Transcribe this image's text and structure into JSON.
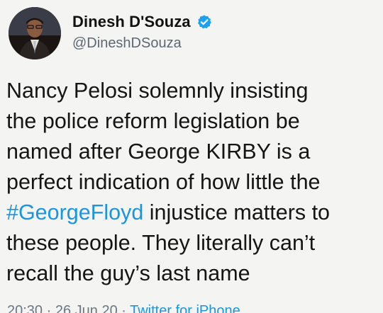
{
  "author": {
    "name": "Dinesh D'Souza",
    "handle": "@DineshDSouza",
    "verified_icon": "verified-badge",
    "verified_color": "#1da1f2"
  },
  "tweet": {
    "line1": "Nancy Pelosi solemnly insisting",
    "line2": "the police reform legislation be",
    "line3": "named after George KIRBY is a",
    "line4": "perfect indication of how little the",
    "hashtag": "#GeorgeFloyd",
    "line5_rest": " injustice matters to",
    "line6": "these people. They literally can’t",
    "line7": "recall the guy’s last  name"
  },
  "meta": {
    "time": "20:30",
    "date": "26 Jun 20",
    "separator": " · ",
    "source": "Twitter for iPhone"
  },
  "colors": {
    "link": "#1b95e0",
    "background": "#f4f4f2"
  }
}
